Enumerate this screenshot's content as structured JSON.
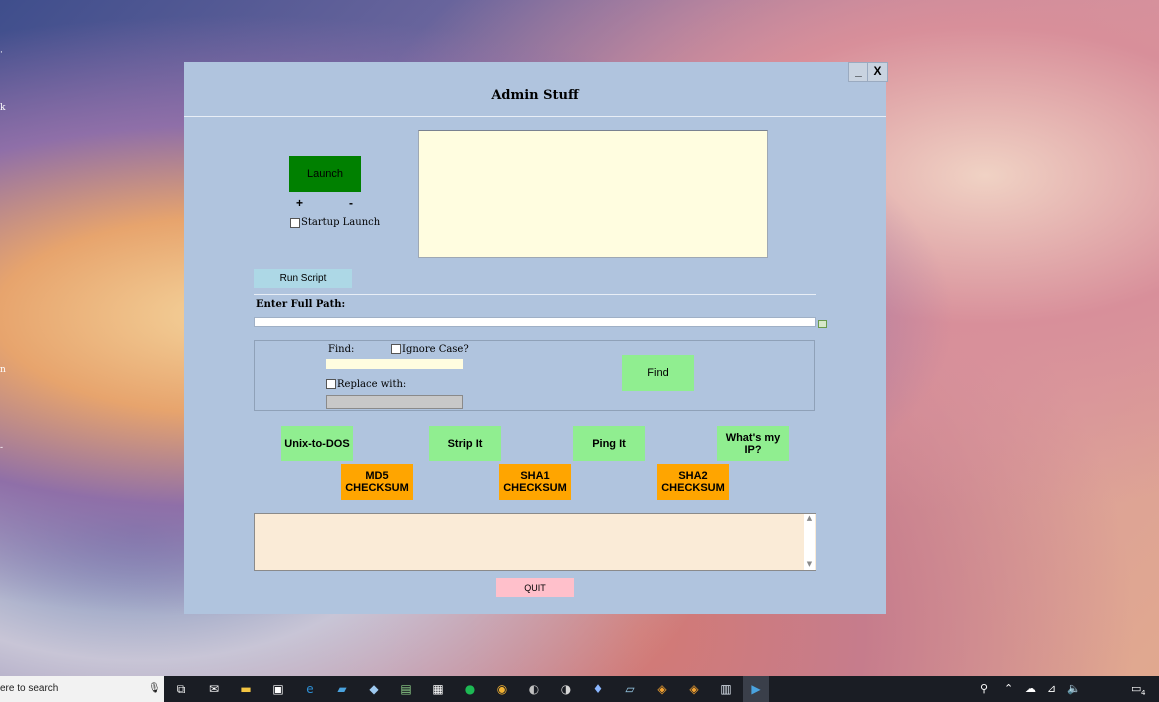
{
  "window": {
    "title": "Admin Stuff",
    "minimize_label": "_",
    "close_label": "X"
  },
  "launch": {
    "button_label": "Launch",
    "plus_label": "+",
    "minus_label": "-",
    "startup_checkbox_label": "Startup Launch",
    "startup_checked": false
  },
  "script": {
    "run_button_label": "Run Script"
  },
  "path": {
    "label": "Enter Full Path:",
    "value": ""
  },
  "find_replace": {
    "find_label": "Find:",
    "find_value": "",
    "ignore_case_label": "Ignore Case?",
    "ignore_case_checked": false,
    "replace_label": "Replace with:",
    "replace_checked": false,
    "replace_value": "",
    "find_button_label": "Find"
  },
  "tools": {
    "row1": [
      "Unix-to-DOS",
      "Strip It",
      "Ping It",
      "What's my IP?"
    ],
    "row2": [
      "MD5 CHECKSUM",
      "SHA1 CHECKSUM",
      "SHA2 CHECKSUM"
    ]
  },
  "output": {
    "value": "",
    "scroll_up": "▲",
    "scroll_down": "▼"
  },
  "quit_label": "QUIT",
  "taskbar": {
    "search_text": "ere to search",
    "mic_icon": "🎙",
    "notification_count": "4"
  },
  "colors": {
    "window_bg": "#b0c4de",
    "launch": "#008000",
    "run_script": "#add8e6",
    "green_buttons": "#90ee90",
    "orange_buttons": "#ffa500",
    "quit": "#ffc0cb",
    "top_text": "#fffde0",
    "output_text": "#faebd7"
  }
}
